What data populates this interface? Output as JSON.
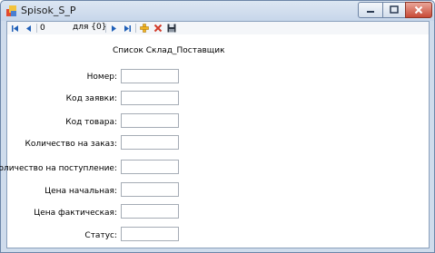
{
  "window": {
    "title": "Spisok_S_P"
  },
  "toolbar": {
    "position_value": "0",
    "count_label": "для {0}"
  },
  "form": {
    "title": "Список Склад_Поставщик",
    "fields": [
      {
        "label": "Номер:",
        "value": ""
      },
      {
        "label": "Код заявки:",
        "value": ""
      },
      {
        "label": "Код товара:",
        "value": ""
      },
      {
        "label": "Количество на заказ:",
        "value": ""
      },
      {
        "label": "Количество на поступление:",
        "value": ""
      },
      {
        "label": "Цена начальная:",
        "value": ""
      },
      {
        "label": "Цена фактическая:",
        "value": ""
      },
      {
        "label": "Статус:",
        "value": ""
      }
    ]
  },
  "colors": {
    "nav_blue": "#1f5fb8",
    "add_yellow": "#f0b323",
    "delete_red": "#d23b2a",
    "close_red": "#c84a36"
  }
}
